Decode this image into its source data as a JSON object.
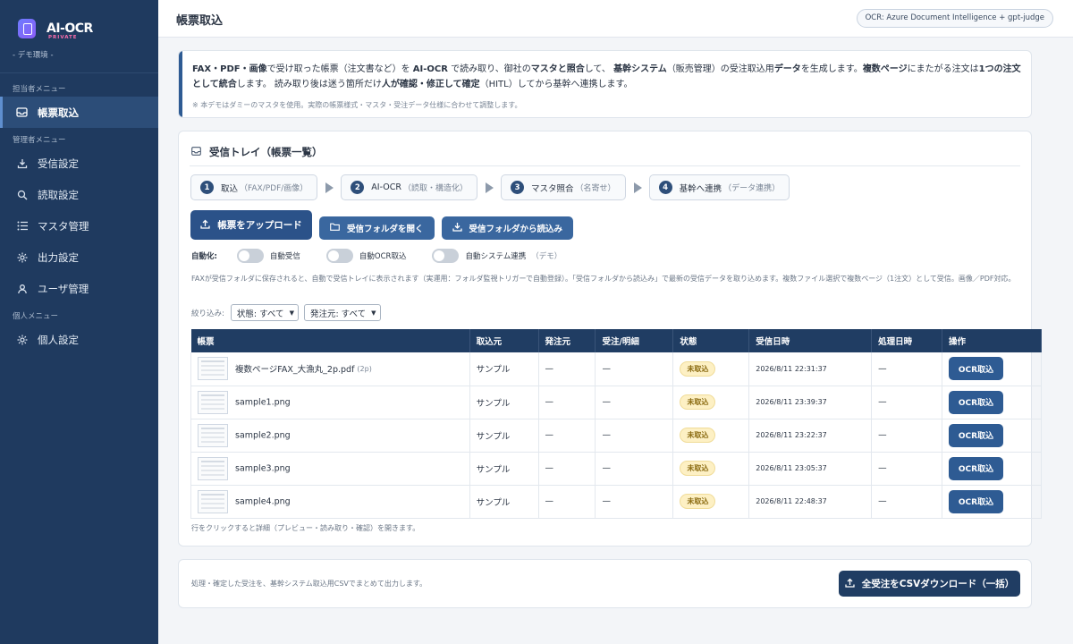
{
  "sidebar": {
    "brand": "AI-OCR",
    "brand_sub": "PRIVATE",
    "env": "- デモ環境 -",
    "sections": [
      {
        "title": "担当者メニュー",
        "items": [
          {
            "label": "帳票取込",
            "icon": "inbox-icon"
          }
        ]
      },
      {
        "title": "管理者メニュー",
        "items": [
          {
            "label": "受信設定",
            "icon": "download-icon"
          },
          {
            "label": "読取設定",
            "icon": "search-icon"
          },
          {
            "label": "マスタ管理",
            "icon": "list-icon"
          },
          {
            "label": "出力設定",
            "icon": "gear-icon"
          },
          {
            "label": "ユーザ管理",
            "icon": "user-icon"
          }
        ]
      },
      {
        "title": "個人メニュー",
        "items": [
          {
            "label": "個人設定",
            "icon": "gear-icon"
          }
        ]
      }
    ]
  },
  "header": {
    "title": "帳票取込",
    "ocr_badge": "OCR: Azure Document Intelligence + gpt-judge"
  },
  "info": {
    "segments": [
      {
        "t": "FAX・PDF・画像",
        "b": true
      },
      {
        "t": "で受け取った帳票（注文書など）を ",
        "b": false
      },
      {
        "t": "AI-OCR",
        "b": true
      },
      {
        "t": " で読み取り、御社の",
        "b": false
      },
      {
        "t": "マスタと照合",
        "b": true
      },
      {
        "t": "して、 ",
        "b": false
      },
      {
        "t": "基幹システム",
        "b": true
      },
      {
        "t": "（販売管理）の受注取込用",
        "b": false
      },
      {
        "t": "データ",
        "b": true
      },
      {
        "t": "を生成します。",
        "b": false
      },
      {
        "t": "複数ページ",
        "b": true
      },
      {
        "t": "にまたがる注文は",
        "b": false
      },
      {
        "t": "1つの注文として統合",
        "b": true
      },
      {
        "t": "します。 読み取り後は迷う箇所だけ",
        "b": false
      },
      {
        "t": "人が確認・修正して確定",
        "b": true
      },
      {
        "t": "（HITL）してから基幹へ連携します。",
        "b": false
      }
    ],
    "note": "※ 本デモはダミーのマスタを使用。実際の帳票様式・マスタ・受注データ仕様に合わせて調整します。"
  },
  "inbox": {
    "title": "受信トレイ（帳票一覧）",
    "steps": [
      {
        "num": "1",
        "label": "取込",
        "sub": "（FAX/PDF/画像）"
      },
      {
        "num": "2",
        "label": "AI-OCR",
        "sub": "（読取・構造化）"
      },
      {
        "num": "3",
        "label": "マスタ照合",
        "sub": "（名寄せ）"
      },
      {
        "num": "4",
        "label": "基幹へ連携",
        "sub": "（データ連携）"
      }
    ],
    "buttons": {
      "upload": "帳票をアップロード",
      "open_folder": "受信フォルダを開く",
      "load_folder": "受信フォルダから読込み"
    },
    "automation": {
      "label": "自動化:",
      "toggles": [
        "自動受信",
        "自動OCR取込",
        "自動システム連携"
      ],
      "demo_note": "（デモ）"
    },
    "description": "FAXが受信フォルダに保存されると、自動で受信トレイに表示されます（実運用：フォルダ監視トリガーで自動登録）。「受信フォルダから読込み」で最新の受信データを取り込めます。複数ファイル選択で複数ページ（1注文）として受信。画像／PDF対応。",
    "filter": {
      "label": "絞り込み:",
      "status": "状態: すべて",
      "source": "発注元: すべて"
    },
    "columns": [
      "帳票",
      "取込元",
      "発注元",
      "受注/明細",
      "状態",
      "受信日時",
      "処理日時",
      "操作"
    ],
    "rows": [
      {
        "file": "複数ページFAX_大漁丸_2p.pdf",
        "pages": "(2p)",
        "source": "サンプル",
        "orderer": "—",
        "detail": "—",
        "status": "未取込",
        "received": "2026/8/11 22:31:37",
        "processed": "—",
        "action": "OCR取込"
      },
      {
        "file": "sample1.png",
        "pages": "",
        "source": "サンプル",
        "orderer": "—",
        "detail": "—",
        "status": "未取込",
        "received": "2026/8/11 23:39:37",
        "processed": "—",
        "action": "OCR取込"
      },
      {
        "file": "sample2.png",
        "pages": "",
        "source": "サンプル",
        "orderer": "—",
        "detail": "—",
        "status": "未取込",
        "received": "2026/8/11 23:22:37",
        "processed": "—",
        "action": "OCR取込"
      },
      {
        "file": "sample3.png",
        "pages": "",
        "source": "サンプル",
        "orderer": "—",
        "detail": "—",
        "status": "未取込",
        "received": "2026/8/11 23:05:37",
        "processed": "—",
        "action": "OCR取込"
      },
      {
        "file": "sample4.png",
        "pages": "",
        "source": "サンプル",
        "orderer": "—",
        "detail": "—",
        "status": "未取込",
        "received": "2026/8/11 22:48:37",
        "processed": "—",
        "action": "OCR取込"
      }
    ],
    "table_note": "行をクリックすると詳細（プレビュー・読み取り・確認）を開きます。"
  },
  "csv": {
    "text": "処理・確定した受注を、基幹システム取込用CSVでまとめて出力します。",
    "button": "全受注をCSVダウンロード（一括）"
  },
  "colors": {
    "sidebar": "#1f3a5f",
    "accent": "#2e5b93",
    "status_pending": "#fdf0c4"
  }
}
